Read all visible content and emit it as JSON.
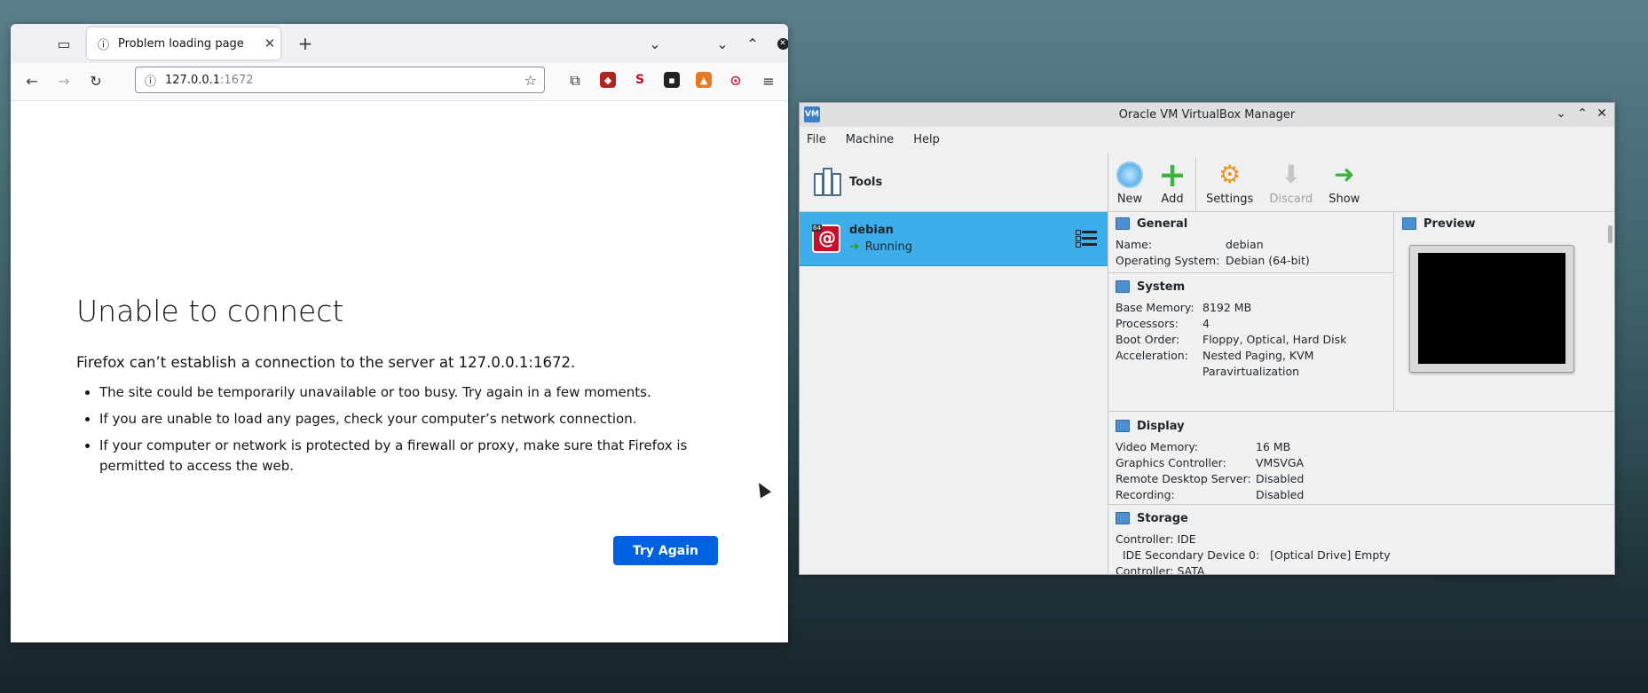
{
  "firefox": {
    "tab_title": "Problem loading page",
    "url_host": "127.0.0.1",
    "url_port": ":1672",
    "error": {
      "title": "Unable to connect",
      "description": "Firefox can’t establish a connection to the server at 127.0.0.1:1672.",
      "bullets": [
        "The site could be temporarily unavailable or too busy. Try again in a few moments.",
        "If you are unable to load any pages, check your computer’s network connection.",
        "If your computer or network is protected by a firewall or proxy, make sure that Firefox is permitted to access the web."
      ],
      "button": "Try Again"
    },
    "extension_colors": [
      "#b22222",
      "#c0102a",
      "#222222",
      "#e8791e",
      "#d2233b"
    ]
  },
  "virtualbox": {
    "title": "Oracle VM VirtualBox Manager",
    "menu": [
      "File",
      "Machine",
      "Help"
    ],
    "tools_label": "Tools",
    "vm": {
      "name": "debian",
      "status": "Running",
      "os_badge": "64"
    },
    "toolbar": [
      "New",
      "Add",
      "Settings",
      "Discard",
      "Show"
    ],
    "general": {
      "title": "General",
      "rows": [
        [
          "Name:",
          "debian"
        ],
        [
          "Operating System:",
          "Debian (64-bit)"
        ]
      ]
    },
    "system": {
      "title": "System",
      "rows": [
        [
          "Base Memory:",
          "8192 MB"
        ],
        [
          "Processors:",
          "4"
        ],
        [
          "Boot Order:",
          "Floppy, Optical, Hard Disk"
        ],
        [
          "Acceleration:",
          "Nested Paging, KVM"
        ],
        [
          "",
          "Paravirtualization"
        ]
      ]
    },
    "preview": {
      "title": "Preview"
    },
    "display": {
      "title": "Display",
      "rows": [
        [
          "Video Memory:",
          "16 MB"
        ],
        [
          "Graphics Controller:",
          "VMSVGA"
        ],
        [
          "Remote Desktop Server:",
          "Disabled"
        ],
        [
          "Recording:",
          "Disabled"
        ]
      ]
    },
    "storage": {
      "title": "Storage",
      "lines": [
        "Controller: IDE",
        "  IDE Secondary Device 0:   [Optical Drive] Empty",
        "Controller: SATA"
      ]
    },
    "selected_color": "#3daee9"
  }
}
